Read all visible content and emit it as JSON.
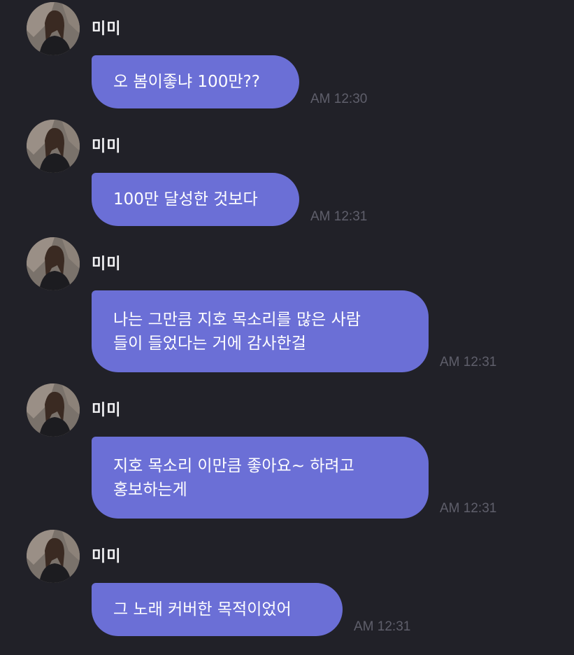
{
  "messages": [
    {
      "sender": "미미",
      "avatar_icon": "profile-photo-icon",
      "lines": [
        "오 봄이좋냐 100만??"
      ],
      "time": "AM 12:30"
    },
    {
      "sender": "미미",
      "avatar_icon": "profile-photo-icon",
      "lines": [
        "100만 달성한 것보다"
      ],
      "time": "AM 12:31"
    },
    {
      "sender": "미미",
      "avatar_icon": "profile-photo-icon",
      "lines": [
        "나는 그만큼 지호 목소리를 많은 사람",
        "들이 들었다는 거에 감사한걸"
      ],
      "time": "AM 12:31"
    },
    {
      "sender": "미미",
      "avatar_icon": "profile-photo-icon",
      "lines": [
        "지호 목소리 이만큼 좋아요~ 하려고",
        "홍보하는게"
      ],
      "time": "AM 12:31"
    },
    {
      "sender": "미미",
      "avatar_icon": "profile-photo-icon",
      "lines": [
        "그 노래 커버한 목적이었어"
      ],
      "time": "AM 12:31"
    }
  ],
  "colors": {
    "background": "#212128",
    "bubble": "#6b6fd6",
    "bubble_text": "#ffffff",
    "name_text": "#f2f2f4",
    "timestamp": "#5f5f6b"
  }
}
